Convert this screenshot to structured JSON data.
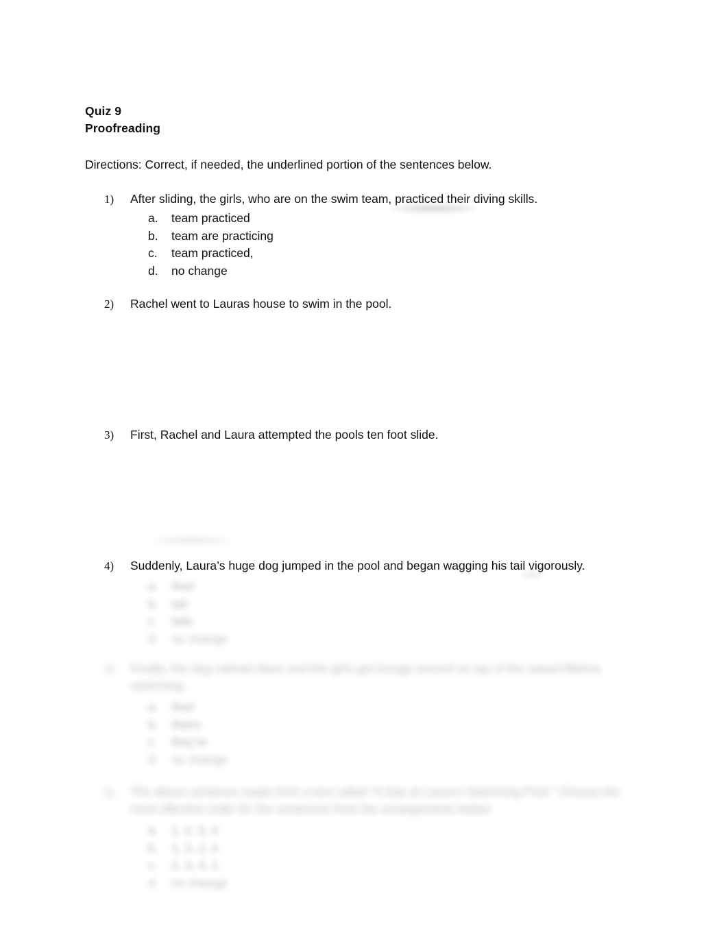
{
  "document": {
    "title_line_1": "Quiz 9",
    "title_line_2": "Proofreading",
    "directions": "Directions: Correct, if needed, the underlined portion of the sentences below.",
    "questions": [
      {
        "number": "1)",
        "text": "After sliding, the girls, who are on the swim team, practiced their diving skills.",
        "options": [
          {
            "letter": "a.",
            "text": "team practiced"
          },
          {
            "letter": "b.",
            "text": "team are practicing"
          },
          {
            "letter": "c.",
            "text": "team practiced,"
          },
          {
            "letter": "d.",
            "text": "no change"
          }
        ]
      },
      {
        "number": "2)",
        "text": "Rachel went to Lauras house to swim in the pool.",
        "options": []
      },
      {
        "number": "3)",
        "text": "First, Rachel and Laura attempted the pools ten foot slide.",
        "options": []
      },
      {
        "number": "4)",
        "text": "Suddenly, Laura’s huge dog jumped in the pool and began wagging his tail vigorously.",
        "options": [
          {
            "letter": "a.",
            "text": "their"
          },
          {
            "letter": "b.",
            "text": "tail"
          },
          {
            "letter": "c.",
            "text": "tails"
          },
          {
            "letter": "d.",
            "text": "no change"
          }
        ]
      },
      {
        "number": "5)",
        "text": "Finally, the dog calmed down and the girls got lounge around on top of the raised lifetime swimming.",
        "options": [
          {
            "letter": "a.",
            "text": "their"
          },
          {
            "letter": "b.",
            "text": "theirs"
          },
          {
            "letter": "c.",
            "text": "they’re"
          },
          {
            "letter": "d.",
            "text": "no change"
          }
        ]
      },
      {
        "number": "6)",
        "text": "The above sentence reads from a text called “A Day at Laura’s Swimming Pool.” Choose the most effective order for the sentences from the arrangements below.",
        "options": [
          {
            "letter": "a.",
            "text": "1, 2, 3, 4"
          },
          {
            "letter": "b.",
            "text": "1, 3, 2, 4"
          },
          {
            "letter": "c.",
            "text": "2, 3, 4, 1"
          },
          {
            "letter": "d.",
            "text": "no change"
          }
        ]
      }
    ]
  }
}
